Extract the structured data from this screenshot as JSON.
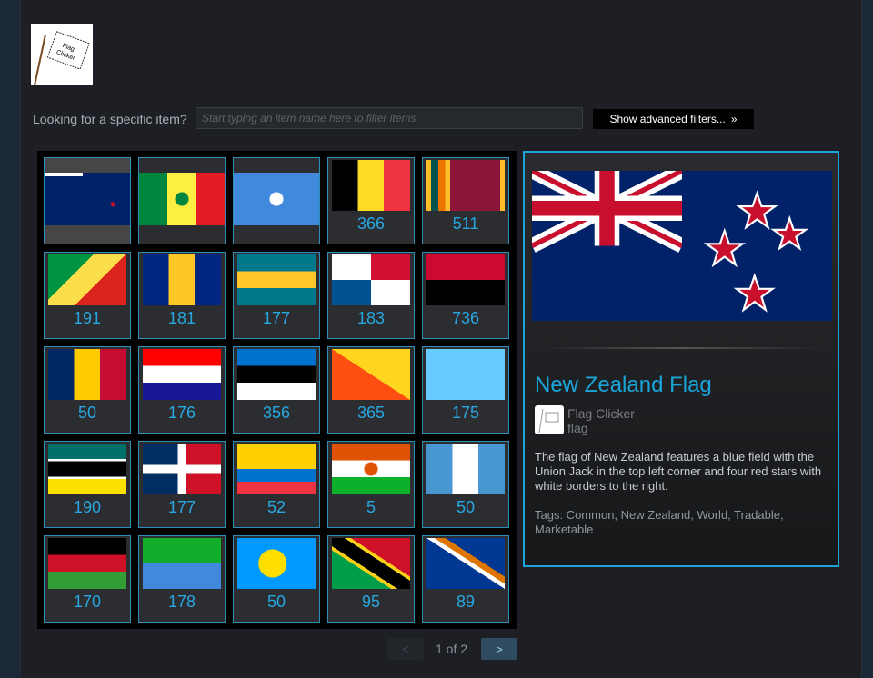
{
  "logo": {
    "text": "Flag Clicker"
  },
  "filter": {
    "label": "Looking for a specific item?",
    "placeholder": "Start typing an item name here to filter items",
    "advanced_label": "Show advanced filters..."
  },
  "items": [
    {
      "flag": "new-zealand",
      "count": null,
      "selected": true
    },
    {
      "flag": "senegal",
      "count": null
    },
    {
      "flag": "somalia",
      "count": null
    },
    {
      "flag": "belgium",
      "count": "366"
    },
    {
      "flag": "sri-lanka",
      "count": "511"
    },
    {
      "flag": "congo",
      "count": "191"
    },
    {
      "flag": "barbados",
      "count": "181"
    },
    {
      "flag": "bahamas",
      "count": "177"
    },
    {
      "flag": "panama",
      "count": "183"
    },
    {
      "flag": "angola",
      "count": "736"
    },
    {
      "flag": "chad",
      "count": "50"
    },
    {
      "flag": "croatia",
      "count": "176"
    },
    {
      "flag": "estonia",
      "count": "356"
    },
    {
      "flag": "bhutan",
      "count": "365"
    },
    {
      "flag": "saint-lucia",
      "count": "175"
    },
    {
      "flag": "mozambique",
      "count": "190"
    },
    {
      "flag": "dominican-republic",
      "count": "177"
    },
    {
      "flag": "ecuador",
      "count": "52"
    },
    {
      "flag": "niger",
      "count": "5"
    },
    {
      "flag": "guatemala",
      "count": "50"
    },
    {
      "flag": "malawi",
      "count": "170"
    },
    {
      "flag": "eritrea",
      "count": "178"
    },
    {
      "flag": "palau",
      "count": "50"
    },
    {
      "flag": "saint-kitts-and-nevis",
      "count": "95"
    },
    {
      "flag": "marshall-islands",
      "count": "89"
    }
  ],
  "detail": {
    "title": "New Zealand Flag",
    "game": "Flag Clicker",
    "type": "flag",
    "description": "The flag of New Zealand features a blue field with the Union Jack in the top left corner and four red stars with white borders to the right.",
    "tags": "Tags: Common, New Zealand, World, Tradable, Marketable"
  },
  "pagination": {
    "prev": "<",
    "next": ">",
    "info": "1 of 2"
  },
  "colors": {
    "accent": "#1aa4d9",
    "count": "#28a7e0"
  }
}
